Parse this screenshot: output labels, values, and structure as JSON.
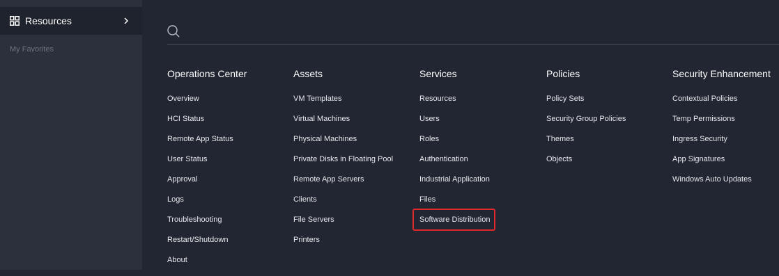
{
  "sidebar": {
    "resources_label": "Resources",
    "favorites_label": "My Favorites",
    "icons": {
      "resources": "grid-icon",
      "expand": "chevron-right-icon"
    }
  },
  "search": {
    "placeholder": "",
    "icon": "search-icon"
  },
  "menu": {
    "columns": [
      {
        "title": "Operations Center",
        "items": [
          "Overview",
          "HCI Status",
          "Remote App Status",
          "User Status",
          "Approval",
          "Logs",
          "Troubleshooting",
          "Restart/Shutdown",
          "About"
        ]
      },
      {
        "title": "Assets",
        "items": [
          "VM Templates",
          "Virtual Machines",
          "Physical Machines",
          "Private Disks in Floating Pool",
          "Remote App Servers",
          "Clients",
          "File Servers",
          "Printers"
        ]
      },
      {
        "title": "Services",
        "items": [
          "Resources",
          "Users",
          "Roles",
          "Authentication",
          "Industrial Application",
          "Files",
          "Software Distribution"
        ]
      },
      {
        "title": "Policies",
        "items": [
          "Policy Sets",
          "Security Group Policies",
          "Themes",
          "Objects"
        ]
      },
      {
        "title": "Security Enhancement",
        "items": [
          "Contextual Policies",
          "Temp Permissions",
          "Ingress Security",
          "App Signatures",
          "Windows Auto Updates"
        ]
      }
    ]
  },
  "colors": {
    "background": "#222632",
    "sidebar": "#2b303c",
    "highlight_border": "#e02a2a"
  }
}
